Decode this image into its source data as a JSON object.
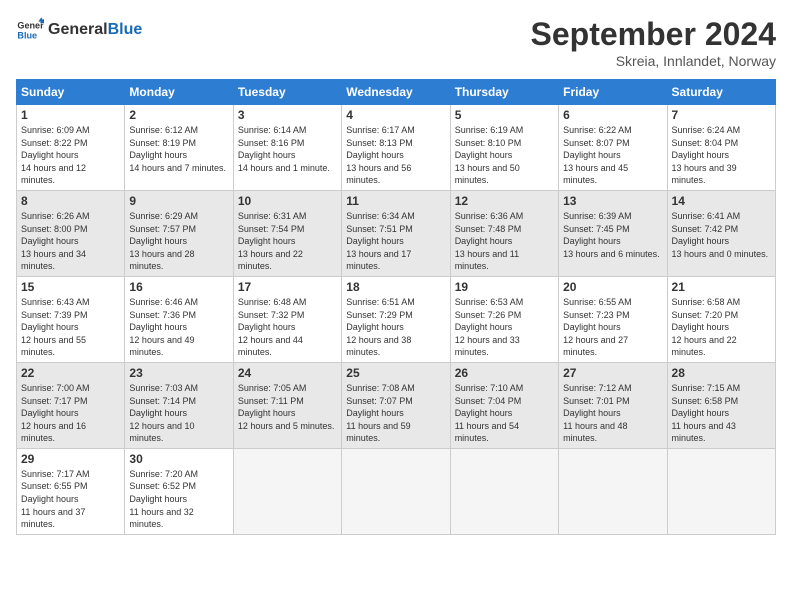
{
  "logo": {
    "text_general": "General",
    "text_blue": "Blue"
  },
  "header": {
    "month_year": "September 2024",
    "location": "Skreia, Innlandet, Norway"
  },
  "weekdays": [
    "Sunday",
    "Monday",
    "Tuesday",
    "Wednesday",
    "Thursday",
    "Friday",
    "Saturday"
  ],
  "weeks": [
    [
      {
        "day": "1",
        "sunrise": "6:09 AM",
        "sunset": "8:22 PM",
        "daylight": "14 hours and 12 minutes."
      },
      {
        "day": "2",
        "sunrise": "6:12 AM",
        "sunset": "8:19 PM",
        "daylight": "14 hours and 7 minutes."
      },
      {
        "day": "3",
        "sunrise": "6:14 AM",
        "sunset": "8:16 PM",
        "daylight": "14 hours and 1 minute."
      },
      {
        "day": "4",
        "sunrise": "6:17 AM",
        "sunset": "8:13 PM",
        "daylight": "13 hours and 56 minutes."
      },
      {
        "day": "5",
        "sunrise": "6:19 AM",
        "sunset": "8:10 PM",
        "daylight": "13 hours and 50 minutes."
      },
      {
        "day": "6",
        "sunrise": "6:22 AM",
        "sunset": "8:07 PM",
        "daylight": "13 hours and 45 minutes."
      },
      {
        "day": "7",
        "sunrise": "6:24 AM",
        "sunset": "8:04 PM",
        "daylight": "13 hours and 39 minutes."
      }
    ],
    [
      {
        "day": "8",
        "sunrise": "6:26 AM",
        "sunset": "8:00 PM",
        "daylight": "13 hours and 34 minutes."
      },
      {
        "day": "9",
        "sunrise": "6:29 AM",
        "sunset": "7:57 PM",
        "daylight": "13 hours and 28 minutes."
      },
      {
        "day": "10",
        "sunrise": "6:31 AM",
        "sunset": "7:54 PM",
        "daylight": "13 hours and 22 minutes."
      },
      {
        "day": "11",
        "sunrise": "6:34 AM",
        "sunset": "7:51 PM",
        "daylight": "13 hours and 17 minutes."
      },
      {
        "day": "12",
        "sunrise": "6:36 AM",
        "sunset": "7:48 PM",
        "daylight": "13 hours and 11 minutes."
      },
      {
        "day": "13",
        "sunrise": "6:39 AM",
        "sunset": "7:45 PM",
        "daylight": "13 hours and 6 minutes."
      },
      {
        "day": "14",
        "sunrise": "6:41 AM",
        "sunset": "7:42 PM",
        "daylight": "13 hours and 0 minutes."
      }
    ],
    [
      {
        "day": "15",
        "sunrise": "6:43 AM",
        "sunset": "7:39 PM",
        "daylight": "12 hours and 55 minutes."
      },
      {
        "day": "16",
        "sunrise": "6:46 AM",
        "sunset": "7:36 PM",
        "daylight": "12 hours and 49 minutes."
      },
      {
        "day": "17",
        "sunrise": "6:48 AM",
        "sunset": "7:32 PM",
        "daylight": "12 hours and 44 minutes."
      },
      {
        "day": "18",
        "sunrise": "6:51 AM",
        "sunset": "7:29 PM",
        "daylight": "12 hours and 38 minutes."
      },
      {
        "day": "19",
        "sunrise": "6:53 AM",
        "sunset": "7:26 PM",
        "daylight": "12 hours and 33 minutes."
      },
      {
        "day": "20",
        "sunrise": "6:55 AM",
        "sunset": "7:23 PM",
        "daylight": "12 hours and 27 minutes."
      },
      {
        "day": "21",
        "sunrise": "6:58 AM",
        "sunset": "7:20 PM",
        "daylight": "12 hours and 22 minutes."
      }
    ],
    [
      {
        "day": "22",
        "sunrise": "7:00 AM",
        "sunset": "7:17 PM",
        "daylight": "12 hours and 16 minutes."
      },
      {
        "day": "23",
        "sunrise": "7:03 AM",
        "sunset": "7:14 PM",
        "daylight": "12 hours and 10 minutes."
      },
      {
        "day": "24",
        "sunrise": "7:05 AM",
        "sunset": "7:11 PM",
        "daylight": "12 hours and 5 minutes."
      },
      {
        "day": "25",
        "sunrise": "7:08 AM",
        "sunset": "7:07 PM",
        "daylight": "11 hours and 59 minutes."
      },
      {
        "day": "26",
        "sunrise": "7:10 AM",
        "sunset": "7:04 PM",
        "daylight": "11 hours and 54 minutes."
      },
      {
        "day": "27",
        "sunrise": "7:12 AM",
        "sunset": "7:01 PM",
        "daylight": "11 hours and 48 minutes."
      },
      {
        "day": "28",
        "sunrise": "7:15 AM",
        "sunset": "6:58 PM",
        "daylight": "11 hours and 43 minutes."
      }
    ],
    [
      {
        "day": "29",
        "sunrise": "7:17 AM",
        "sunset": "6:55 PM",
        "daylight": "11 hours and 37 minutes."
      },
      {
        "day": "30",
        "sunrise": "7:20 AM",
        "sunset": "6:52 PM",
        "daylight": "11 hours and 32 minutes."
      },
      null,
      null,
      null,
      null,
      null
    ]
  ]
}
